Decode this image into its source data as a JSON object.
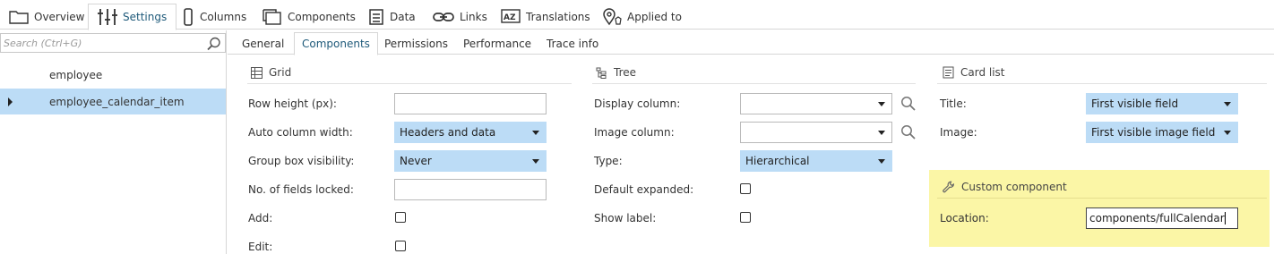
{
  "top_tabs": [
    {
      "label": "Overview",
      "icon": "folder-icon"
    },
    {
      "label": "Settings",
      "icon": "sliders-icon",
      "active": true
    },
    {
      "label": "Columns",
      "icon": "column-icon"
    },
    {
      "label": "Components",
      "icon": "components-icon"
    },
    {
      "label": "Data",
      "icon": "database-icon"
    },
    {
      "label": "Links",
      "icon": "link-icon"
    },
    {
      "label": "Translations",
      "icon": "translate-icon"
    },
    {
      "label": "Applied to",
      "icon": "map-pin-icon"
    }
  ],
  "search": {
    "placeholder": "Search (Ctrl+G)"
  },
  "tree": [
    {
      "label": "employee"
    },
    {
      "label": "employee_calendar_item",
      "selected": true,
      "expandable": true
    }
  ],
  "sub_tabs": [
    {
      "label": "General"
    },
    {
      "label": "Components",
      "active": true
    },
    {
      "label": "Permissions"
    },
    {
      "label": "Performance"
    },
    {
      "label": "Trace info"
    }
  ],
  "grid": {
    "title": "Grid",
    "row_height_label": "Row height (px):",
    "row_height_value": "",
    "auto_column_width_label": "Auto column width:",
    "auto_column_width_value": "Headers and data",
    "group_box_visibility_label": "Group box visibility:",
    "group_box_visibility_value": "Never",
    "fields_locked_label": "No. of fields locked:",
    "fields_locked_value": "",
    "add_label": "Add:",
    "add_checked": false,
    "edit_label": "Edit:",
    "edit_checked": false
  },
  "tree_section": {
    "title": "Tree",
    "display_column_label": "Display column:",
    "display_column_value": "",
    "image_column_label": "Image column:",
    "image_column_value": "",
    "type_label": "Type:",
    "type_value": "Hierarchical",
    "default_expanded_label": "Default expanded:",
    "default_expanded_checked": false,
    "show_label_label": "Show label:",
    "show_label_checked": false
  },
  "card_list": {
    "title": "Card list",
    "title_label": "Title:",
    "title_value": "First visible field",
    "image_label": "Image:",
    "image_value": "First visible image field"
  },
  "custom_component": {
    "title": "Custom component",
    "location_label": "Location:",
    "location_value": "components/fullCalendar",
    "highlight_color": "#fbf6a6"
  },
  "colors": {
    "selected_bg": "#bcdcf6",
    "accent_text": "#1f5a7a"
  }
}
